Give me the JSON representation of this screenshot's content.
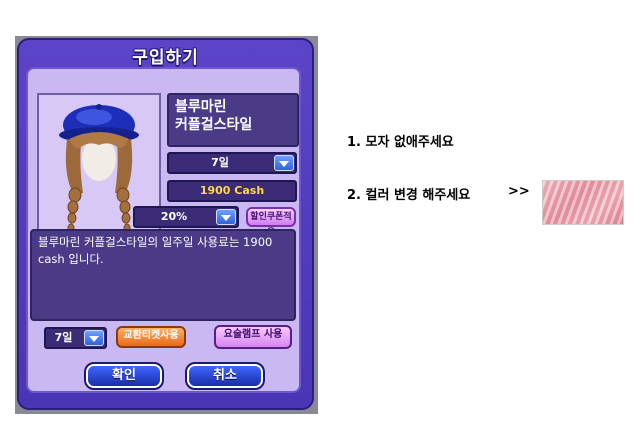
{
  "window": {
    "title": "구입하기"
  },
  "item": {
    "name_line1": "블루마린",
    "name_line2": "커플걸스타일"
  },
  "period_dropdown": {
    "value": "7일"
  },
  "price": {
    "text": "1900 Cash"
  },
  "discount_dropdown": {
    "value": "20%"
  },
  "buttons": {
    "coupon": "할인쿠폰적용",
    "exchange_ticket": "교환티켓사용",
    "camp": "요술램프 사용",
    "confirm": "확인",
    "cancel": "취소"
  },
  "description": "블루마린 커플걸스타일의 일주일 사용료는 1900 cash 입니다.",
  "bottom_period_dropdown": {
    "value": "7일"
  },
  "notes": {
    "note1": "1. 모자 없애주세요",
    "note2": "2. 컬러 변경 해주세요",
    "arrow": ">>"
  },
  "colors": {
    "window": "#5b44c8",
    "panel": "#c9b8f2",
    "price_text": "#ffd84a",
    "swatch": "#eaa3b0"
  }
}
